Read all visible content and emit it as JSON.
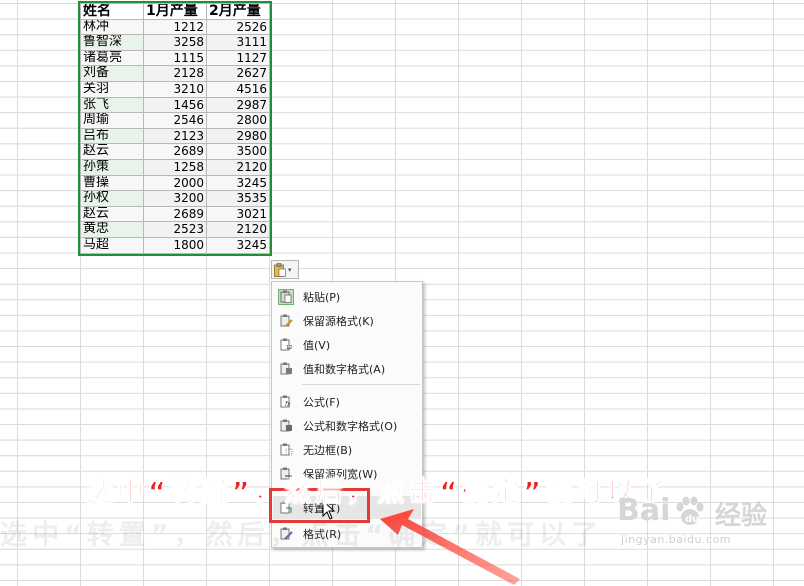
{
  "sheet": {
    "headers": [
      "姓名",
      "1月产量",
      "2月产量"
    ],
    "rows": [
      [
        "林冲",
        "1212",
        "2526"
      ],
      [
        "鲁智深",
        "3258",
        "3111"
      ],
      [
        "诸葛亮",
        "1115",
        "1127"
      ],
      [
        "刘备",
        "2128",
        "2627"
      ],
      [
        "关羽",
        "3210",
        "4516"
      ],
      [
        "张飞",
        "1456",
        "2987"
      ],
      [
        "周瑜",
        "2546",
        "2800"
      ],
      [
        "吕布",
        "2123",
        "2980"
      ],
      [
        "赵云",
        "2689",
        "3500"
      ],
      [
        "孙策",
        "1258",
        "2120"
      ],
      [
        "曹操",
        "2000",
        "3245"
      ],
      [
        "孙权",
        "3200",
        "3535"
      ],
      [
        "赵云",
        "2689",
        "3021"
      ],
      [
        "黄忠",
        "2523",
        "2120"
      ],
      [
        "马超",
        "1800",
        "3245"
      ]
    ]
  },
  "paste_options": {
    "button_icon": "clipboard-icon",
    "items": [
      {
        "label": "粘贴(P)",
        "icon": "paste-icon"
      },
      {
        "label": "保留源格式(K)",
        "icon": "keep-source-format-icon"
      },
      {
        "label": "值(V)",
        "icon": "paste-values-icon"
      },
      {
        "label": "值和数字格式(A)",
        "icon": "values-number-format-icon"
      },
      {
        "label": "公式(F)",
        "icon": "formula-icon"
      },
      {
        "label": "公式和数字格式(O)",
        "icon": "formula-number-format-icon"
      },
      {
        "label": "无边框(B)",
        "icon": "no-border-icon"
      },
      {
        "label": "保留源列宽(W)",
        "icon": "keep-column-width-icon"
      },
      {
        "label": "转置(T)",
        "icon": "transpose-icon"
      },
      {
        "label": "格式(R)",
        "icon": "format-icon"
      }
    ]
  },
  "annotation": {
    "caption": "选中“转置”，然后，点击“确定”就可以了",
    "highlight_color": "#e53935"
  },
  "watermark": {
    "brand": "Bai",
    "brand_suffix": "经验",
    "url": "jingyan.baidu.com"
  },
  "colors": {
    "selection_border": "#1f8f3a",
    "caption": "#ef2020"
  }
}
